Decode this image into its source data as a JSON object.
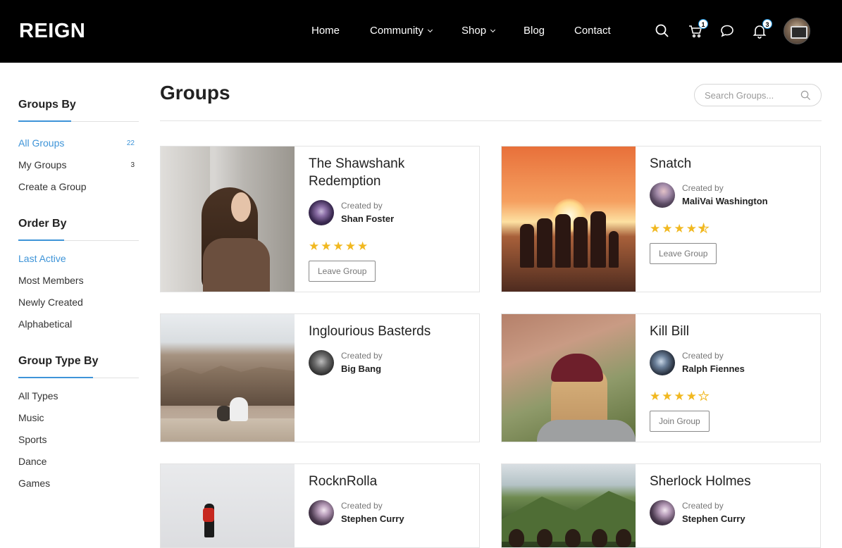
{
  "header": {
    "logo": "REIGN",
    "nav": [
      {
        "label": "Home",
        "has_dropdown": false
      },
      {
        "label": "Community",
        "has_dropdown": true
      },
      {
        "label": "Shop",
        "has_dropdown": true
      },
      {
        "label": "Blog",
        "has_dropdown": false
      },
      {
        "label": "Contact",
        "has_dropdown": false
      }
    ],
    "icons": {
      "search": "search-icon",
      "cart": "cart-icon",
      "messages": "chat-icon",
      "notifications": "bell-icon"
    },
    "cart_count": "1",
    "notification_count": "3"
  },
  "sidebar": {
    "groups_by": {
      "title": "Groups By",
      "items": [
        {
          "label": "All Groups",
          "count": "22",
          "active": true
        },
        {
          "label": "My Groups",
          "count": "3",
          "active": false
        },
        {
          "label": "Create a Group",
          "count": "",
          "active": false
        }
      ]
    },
    "order_by": {
      "title": "Order By",
      "items": [
        {
          "label": "Last Active",
          "active": true
        },
        {
          "label": "Most Members",
          "active": false
        },
        {
          "label": "Newly Created",
          "active": false
        },
        {
          "label": "Alphabetical",
          "active": false
        }
      ]
    },
    "group_type_by": {
      "title": "Group Type By",
      "items": [
        {
          "label": "All Types"
        },
        {
          "label": "Music"
        },
        {
          "label": "Sports"
        },
        {
          "label": "Dance"
        },
        {
          "label": "Games"
        }
      ]
    }
  },
  "main": {
    "title": "Groups",
    "search_placeholder": "Search Groups..."
  },
  "created_by_label": "Created by",
  "groups": [
    {
      "title": "The Shawshank Redemption",
      "creator": "Shan Foster",
      "rating": 5,
      "button": "Leave Group"
    },
    {
      "title": "Snatch",
      "creator": "MaliVai Washington",
      "rating": 4.5,
      "button": "Leave Group"
    },
    {
      "title": "Inglourious Basterds",
      "creator": "Big Bang",
      "rating": 0,
      "button": ""
    },
    {
      "title": "Kill Bill",
      "creator": "Ralph Fiennes",
      "rating": 4,
      "button": "Join Group"
    },
    {
      "title": "RocknRolla",
      "creator": "Stephen Curry",
      "rating": 0,
      "button": ""
    },
    {
      "title": "Sherlock Holmes",
      "creator": "Stephen Curry",
      "rating": 0,
      "button": ""
    }
  ],
  "colors": {
    "accent": "#3e94d8",
    "star": "#f1b820",
    "header_bg": "#000000"
  }
}
